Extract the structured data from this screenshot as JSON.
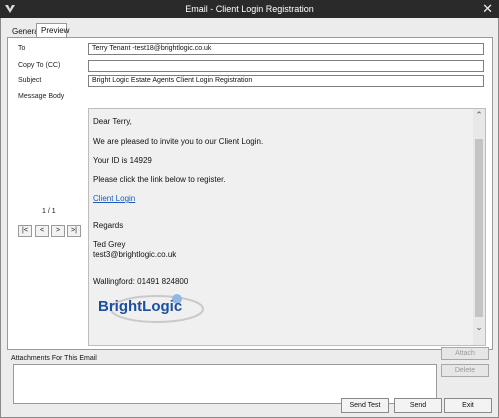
{
  "window": {
    "title": "Email - Client Login Registration",
    "close_glyph": "✕"
  },
  "tabs": [
    {
      "label": "General"
    },
    {
      "label": "Preview"
    }
  ],
  "fields": {
    "to": {
      "label": "To",
      "value": "Terry Tenant -test18@brightlogic.co.uk"
    },
    "cc": {
      "label": "Copy To (CC)",
      "value": ""
    },
    "subject": {
      "label": "Subject",
      "value": "Bright Logic Estate Agents Client Login Registration"
    },
    "body_label": "Message Body"
  },
  "message": {
    "greeting": "Dear Terry,",
    "line1": "We are pleased to invite you to our Client Login.",
    "line2": "Your ID is 14929",
    "line3": "Please click the link below to register.",
    "link": "Client Login",
    "regards": "Regards",
    "sender_name": "Ted Grey",
    "sender_email": "test3@brightlogic.co.uk",
    "office": "Wallingford: 01491 824800",
    "logo_text": "BrightLogic"
  },
  "pager": {
    "count": "1 / 1",
    "first": "|<",
    "prev": "<",
    "next": ">",
    "last": ">|"
  },
  "attachments": {
    "label": "Attachments For This Email",
    "attach_button": "Attach",
    "delete_button": "Delete"
  },
  "footer": {
    "send_test": "Send Test",
    "send": "Send",
    "exit": "Exit"
  },
  "colors": {
    "titlebar": "#2a2a2a",
    "link": "#1a5cc0",
    "logo_blue": "#1d4fa0"
  },
  "icons": {
    "app": "app-logo-icon",
    "close": "close-icon",
    "scroll_up": "chevron-up-icon",
    "scroll_down": "chevron-down-icon"
  }
}
